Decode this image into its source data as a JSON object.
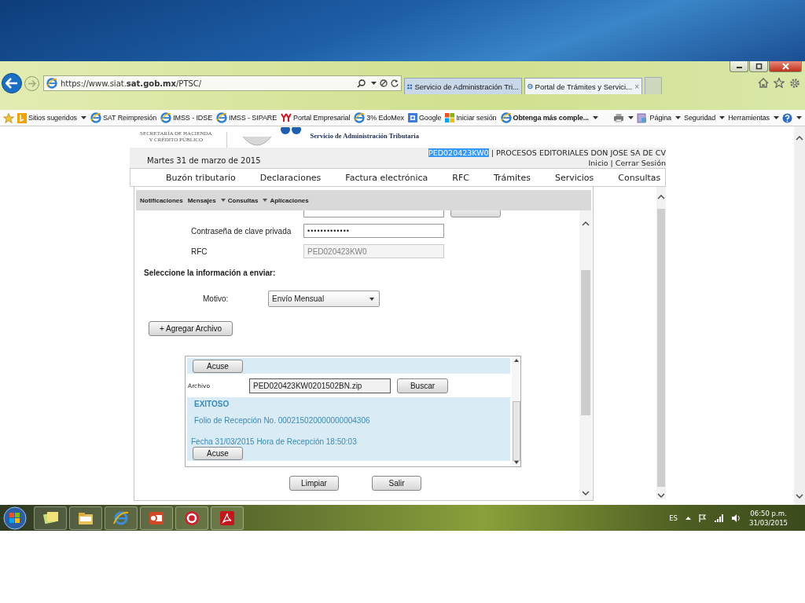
{
  "browser": {
    "address": "https://www.siat.**sat.gob.mx**/PTSC/",
    "tabs": [
      {
        "label": "Servicio de Administración Tri...",
        "kind": "sat",
        "selected": false
      },
      {
        "label": "Portal de Trámites y Servici...",
        "kind": "ie",
        "selected": true,
        "close": "×"
      }
    ],
    "favorites": [
      {
        "label": "Sitios sugeridos",
        "kind": "bing",
        "menu": true,
        "bold": false
      },
      {
        "label": "SAT Reimpresión",
        "kind": "ie",
        "menu": false,
        "bold": false
      },
      {
        "label": "IMSS - IDSE",
        "kind": "ie",
        "menu": false,
        "bold": false
      },
      {
        "label": "IMSS - SIPARE",
        "kind": "ie",
        "menu": false,
        "bold": false
      },
      {
        "label": "Portal Empresarial",
        "kind": "portal",
        "menu": false,
        "bold": false
      },
      {
        "label": "3% EdoMex",
        "kind": "ie",
        "menu": false,
        "bold": false
      },
      {
        "label": "Google",
        "kind": "google",
        "menu": false,
        "bold": false
      },
      {
        "label": "Iniciar sesión",
        "kind": "windows",
        "menu": false,
        "bold": false
      },
      {
        "label": "Obtenga más comple...",
        "kind": "ie",
        "menu": true,
        "bold": true
      }
    ],
    "commands": [
      {
        "label": "Página",
        "menu": true
      },
      {
        "label": "Seguridad",
        "menu": true
      },
      {
        "label": "Herramientas",
        "menu": true
      }
    ]
  },
  "page": {
    "agency": [
      "SECRETARÍA DE HACIENDA",
      "Y CRÉDITO PÚBLICO"
    ],
    "agency_subtitle": "Servicio de Administración Tributaria",
    "date": "Martes 31 de marzo de 2015",
    "rfc": {
      "text": "PED020423KW0",
      "highlighted": true
    },
    "company": "| PROCESOS EDITORIALES DON JOSE SA DE CV",
    "links": [
      "Inicio",
      "Cerrar Sesión"
    ],
    "link_separator": "|",
    "menu": [
      "Buzón tributario",
      "Declaraciones",
      "Factura electrónica",
      "RFC",
      "Trámites",
      "Servicios",
      "Consultas"
    ],
    "submenu": [
      {
        "label": "Notificaciones",
        "menu": false
      },
      {
        "label": "Mensajes",
        "menu": false
      },
      {
        "label": "Consultas",
        "menu": true
      },
      {
        "label": "Aplicaciones",
        "menu": true
      }
    ],
    "form": {
      "fields": [
        {
          "label": "Contraseña de clave privada",
          "kind": "password",
          "value": "•••••••••••••"
        },
        {
          "label": "RFC",
          "kind": "readonly",
          "value": "PED020423KW0"
        }
      ],
      "section_title": "Seleccione la información a enviar:",
      "motivo": {
        "label": "Motivo:",
        "value": "Envío Mensual"
      },
      "add_button": "+ Agregar Archivo",
      "upload": {
        "top_button": "Acuse",
        "file_label": "Archivo",
        "file_value": "PED020423KW0201502BN.zip",
        "browse_button": "Buscar",
        "status": "EXITOSO",
        "folio": "Folio de Recepción No. 000215020000000004306",
        "fecha": "Fecha 31/03/2015 Hora de Recepción 18:50:03",
        "result_button": "Acuse"
      },
      "buttons": [
        "Limpiar",
        "Salir"
      ]
    }
  },
  "taskbar": {
    "apps": [
      {
        "kind": "notes"
      },
      {
        "kind": "folder"
      },
      {
        "kind": "ie"
      },
      {
        "kind": "slides"
      },
      {
        "kind": "cf"
      },
      {
        "kind": "pdf"
      }
    ],
    "language": "ES",
    "time": "06:50 p.m.",
    "date": "31/03/2015"
  }
}
